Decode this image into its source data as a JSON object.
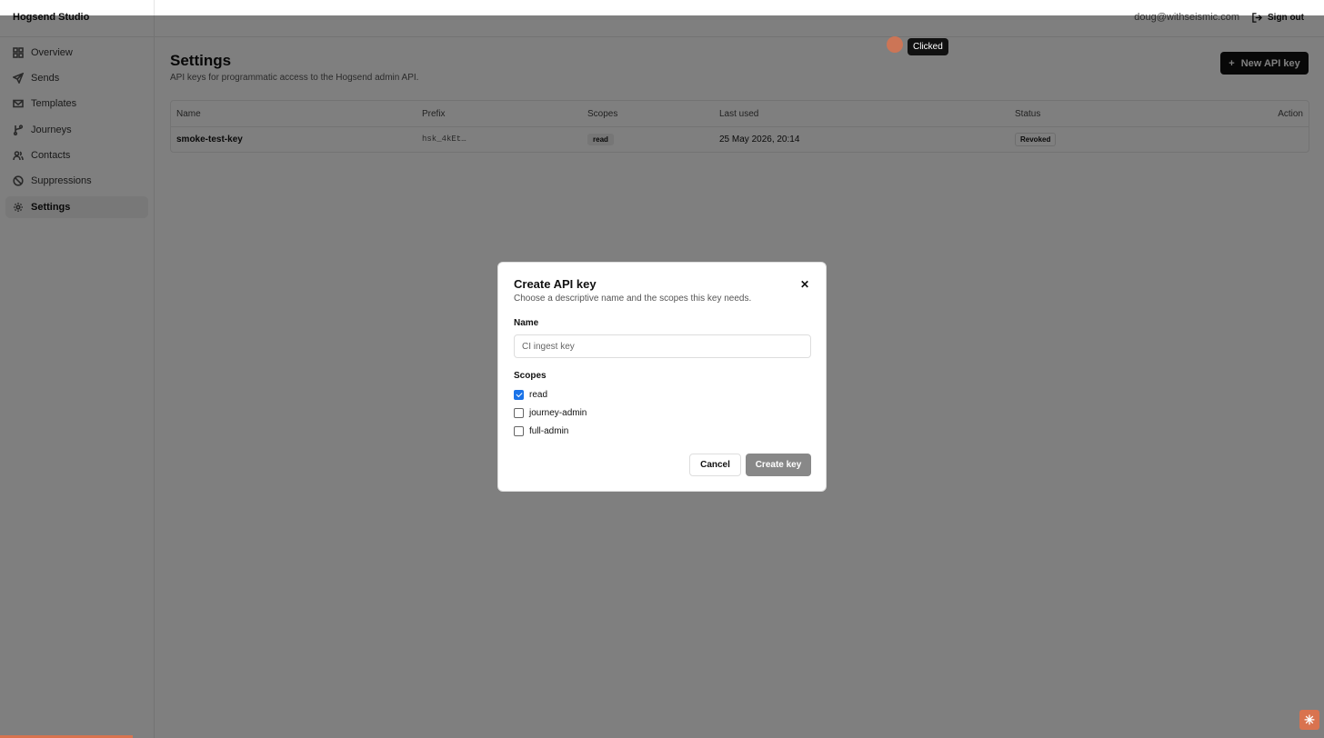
{
  "app": {
    "brand": "Hogsend Studio",
    "user_email": "doug@withseismic.com",
    "sign_out_label": "Sign out"
  },
  "sidebar": {
    "items": [
      {
        "label": "Overview",
        "icon": "grid-icon",
        "active": false
      },
      {
        "label": "Sends",
        "icon": "send-icon",
        "active": false
      },
      {
        "label": "Templates",
        "icon": "mail-icon",
        "active": false
      },
      {
        "label": "Journeys",
        "icon": "branch-icon",
        "active": false
      },
      {
        "label": "Contacts",
        "icon": "users-icon",
        "active": false
      },
      {
        "label": "Suppressions",
        "icon": "ban-icon",
        "active": false
      },
      {
        "label": "Settings",
        "icon": "gear-icon",
        "active": true
      }
    ]
  },
  "main": {
    "title": "Settings",
    "subtitle": "API keys for programmatic access to the Hogsend admin API.",
    "new_key_label": "New API key",
    "table": {
      "headers": [
        "Name",
        "Prefix",
        "Scopes",
        "Last used",
        "Status",
        "Action"
      ],
      "rows": [
        {
          "name": "smoke-test-key",
          "prefix": "hsk_4kEt…",
          "scope": "read",
          "last_used": "25 May 2026, 20:14",
          "status": "Revoked"
        }
      ]
    }
  },
  "toast": {
    "label": "Clicked"
  },
  "modal": {
    "title": "Create API key",
    "description": "Choose a descriptive name and the scopes this key needs.",
    "name_label": "Name",
    "name_placeholder": "CI ingest key",
    "scopes_label": "Scopes",
    "scopes": [
      {
        "label": "read",
        "checked": true
      },
      {
        "label": "journey-admin",
        "checked": false
      },
      {
        "label": "full-admin",
        "checked": false
      }
    ],
    "cancel_label": "Cancel",
    "create_label": "Create key"
  },
  "colors": {
    "accent": "#d9734f",
    "checkbox": "#1a73e8",
    "primary_button": "#111111"
  }
}
